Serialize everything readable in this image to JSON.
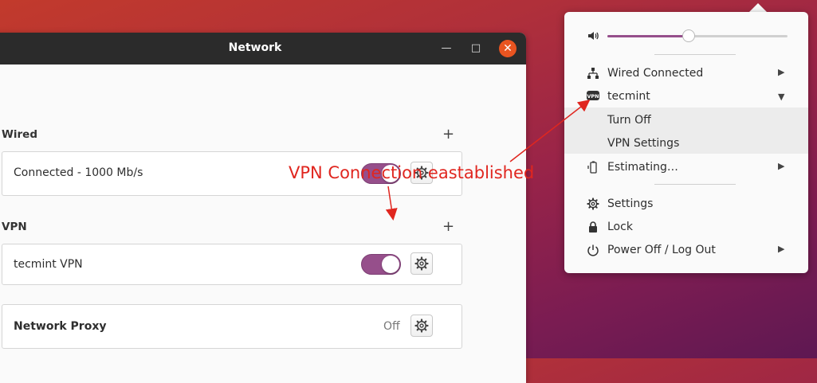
{
  "window": {
    "title": "Network",
    "minimize_glyph": "—",
    "maximize_glyph": "□",
    "close_glyph": "✕"
  },
  "wired": {
    "section_label": "Wired",
    "connection_label": "Connected - 1000 Mb/s",
    "enabled": true
  },
  "vpn": {
    "section_label": "VPN",
    "connection_label": "tecmint VPN",
    "enabled": true
  },
  "proxy": {
    "label": "Network Proxy",
    "status": "Off"
  },
  "annotation": {
    "text": "VPN Connection eastablished",
    "color": "#e0261f"
  },
  "system_menu": {
    "volume_level": 0.45,
    "items": {
      "wired": "Wired Connected",
      "vpn": "tecmint",
      "vpn_turn_off": "Turn Off",
      "vpn_settings": "VPN Settings",
      "battery": "Estimating…",
      "settings": "Settings",
      "lock": "Lock",
      "power": "Power Off / Log Out"
    },
    "vpn_icon_text": "VPN"
  },
  "colors": {
    "accent": "#964f8b",
    "close": "#e95420",
    "titlebar": "#2b2b2b"
  }
}
